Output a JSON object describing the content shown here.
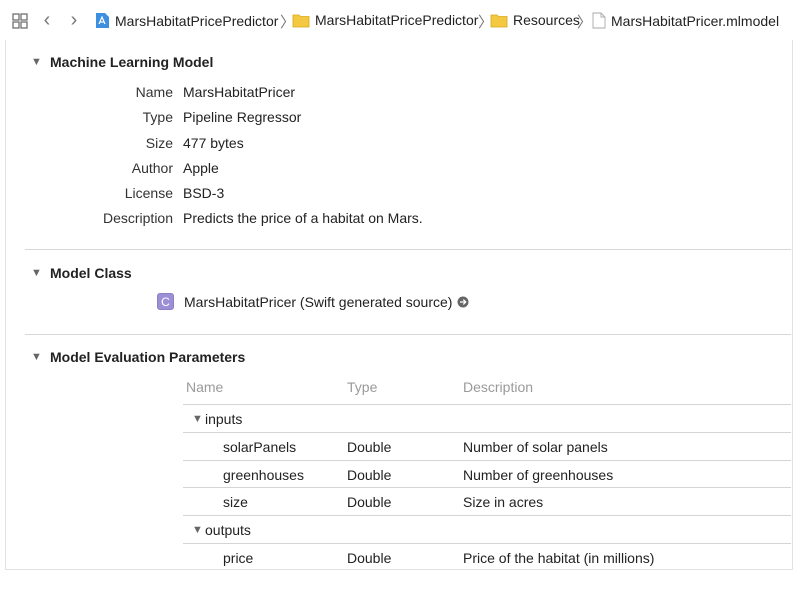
{
  "breadcrumb": {
    "items": [
      {
        "label": "MarsHabitatPricePredictor",
        "icon": "xcode-project-icon"
      },
      {
        "label": "MarsHabitatPricePredictor",
        "icon": "folder-icon"
      },
      {
        "label": "Resources",
        "icon": "folder-icon"
      },
      {
        "label": "MarsHabitatPricer.mlmodel",
        "icon": "file-icon"
      }
    ]
  },
  "colors": {
    "folder": "#f5c842",
    "class_badge": "#9c8fd6",
    "project_icon": "#3d8fe0"
  },
  "ml_model": {
    "title": "Machine Learning Model",
    "fields": [
      {
        "label": "Name",
        "value": "MarsHabitatPricer"
      },
      {
        "label": "Type",
        "value": "Pipeline Regressor"
      },
      {
        "label": "Size",
        "value": "477 bytes"
      },
      {
        "label": "Author",
        "value": "Apple"
      },
      {
        "label": "License",
        "value": "BSD-3"
      },
      {
        "label": "Description",
        "value": "Predicts the price of a habitat on Mars."
      }
    ]
  },
  "model_class": {
    "title": "Model Class",
    "badge": "C",
    "text": "MarsHabitatPricer (Swift generated source)"
  },
  "eval_params": {
    "title": "Model Evaluation Parameters",
    "columns": [
      "Name",
      "Type",
      "Description"
    ],
    "inputs_label": "inputs",
    "inputs": [
      {
        "name": "solarPanels",
        "type": "Double",
        "description": "Number of solar panels"
      },
      {
        "name": "greenhouses",
        "type": "Double",
        "description": "Number of greenhouses"
      },
      {
        "name": "size",
        "type": "Double",
        "description": "Size in acres"
      }
    ],
    "outputs_label": "outputs",
    "outputs": [
      {
        "name": "price",
        "type": "Double",
        "description": "Price of the habitat (in millions)"
      }
    ]
  }
}
